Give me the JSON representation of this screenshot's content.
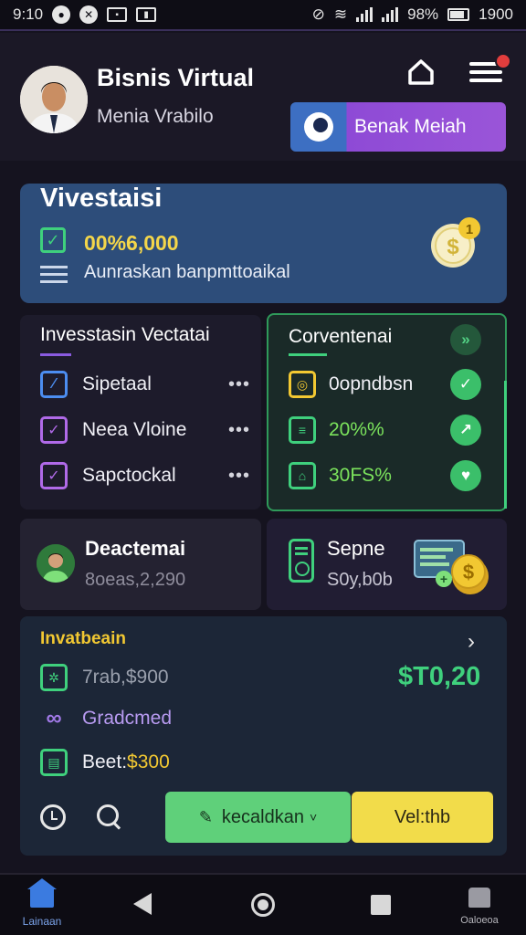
{
  "status_bar": {
    "time": "9:10",
    "battery": "98%",
    "clock": "1900"
  },
  "header": {
    "title": "Bisnis Virtual",
    "subtitle": "Menia Vrabilo",
    "cta_label": "Benak Meiah",
    "notification_color": "#e23d3d"
  },
  "balance": {
    "title": "Vivestaisi",
    "amount": "00%6,000",
    "description": "Aunraskan banpmttoaikal",
    "coin_badge": "1"
  },
  "investment_list": {
    "title": "Invesstasin Vectatai",
    "items": [
      {
        "label": "Sipetaal",
        "more": "•••",
        "icon": "crosshair-icon",
        "color": "#4c8df0"
      },
      {
        "label": "Neea Vloine",
        "more": "•••",
        "icon": "checkbox-icon",
        "color": "#b06ae8"
      },
      {
        "label": "Sapctockal",
        "more": "•••",
        "icon": "checkbox-icon",
        "color": "#b06ae8"
      }
    ]
  },
  "conversion": {
    "title": "Corventenai",
    "items": [
      {
        "label": "0opndbsn",
        "icon": "target-icon",
        "status_icon": "check-icon"
      },
      {
        "label": "20%%",
        "icon": "document-icon",
        "status_icon": "trend-icon"
      },
      {
        "label": "30FS%",
        "icon": "lock-icon",
        "status_icon": "heart-icon"
      }
    ],
    "accent": "#3fd07d"
  },
  "deposit": {
    "title": "Deactemai",
    "value": "8oeas,2,290"
  },
  "september": {
    "title": "Sepne",
    "value": "S0y,b0b"
  },
  "investment_summary": {
    "title": "Invatbeain",
    "amount": "$T0,20",
    "rows": [
      {
        "label": "7rab,$900",
        "icon": "gear-icon"
      },
      {
        "label": "Gradcmed",
        "icon": "infinity-icon"
      },
      {
        "label_prefix": "Beet:",
        "label_amount": "$300",
        "icon": "receipt-icon"
      }
    ],
    "primary_button": "kecaldkan",
    "secondary_button": "Vel:thb"
  },
  "navbar": {
    "home_label": "Lainaan",
    "right_label": "Oaloeoa"
  }
}
